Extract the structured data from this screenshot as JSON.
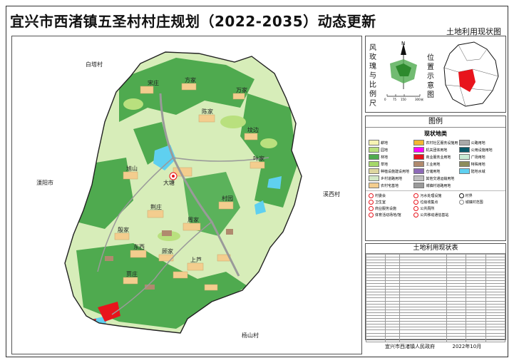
{
  "title": "宜兴市西渚镇五圣村村庄规划（2022-2035）动态更新",
  "subtitle": "土地利用现状图",
  "map": {
    "places": {
      "baita": "白塔村",
      "liyang": "溧阳市",
      "xixi": "溪西村",
      "yangshan": "杨山村"
    },
    "villages": [
      "宋庄",
      "方家",
      "大塘",
      "万家",
      "陈家",
      "坟边",
      "旭山",
      "叶家",
      "村园",
      "荆庄",
      "周家",
      "殷家",
      "东西",
      "顾家",
      "上芦",
      "贾庄"
    ]
  },
  "compass": {
    "label": "风玫瑰与比例尺",
    "north": "N",
    "scale_ticks": [
      "0",
      "75",
      "150",
      "300"
    ],
    "scale_unit": "米"
  },
  "location": {
    "label": "位置示意图"
  },
  "legend": {
    "title": "图例",
    "subtitle": "现状地类",
    "items": [
      {
        "label": "耕地",
        "color": "#f6f3b4"
      },
      {
        "label": "农村社区服务设施用地",
        "color": "#f2b733"
      },
      {
        "label": "公路用地",
        "color": "#a9a9a9"
      },
      {
        "label": "园地",
        "color": "#b9e07e"
      },
      {
        "label": "机关团体用地",
        "color": "#ff00ff"
      },
      {
        "label": "公用设施用地",
        "color": "#0a5a6a"
      },
      {
        "label": "林地",
        "color": "#4faa4f"
      },
      {
        "label": "商业服务业用地",
        "color": "#e8141c"
      },
      {
        "label": "广场用地",
        "color": "#c8ecd4"
      },
      {
        "label": "草地",
        "color": "#a5d86a"
      },
      {
        "label": "工业用地",
        "color": "#b08a6e"
      },
      {
        "label": "特殊用地",
        "color": "#8d8d5c"
      },
      {
        "label": "种植设施建设用地",
        "color": "#ddd6a0"
      },
      {
        "label": "仓储用地",
        "color": "#8e6ab8"
      },
      {
        "label": "陆地水域",
        "color": "#5fd0f0"
      },
      {
        "label": "乡村道路用地",
        "color": "#d2e8c6"
      },
      {
        "label": "其他交通运输用地",
        "color": "#bfbfbf"
      },
      {
        "label": "",
        "color": ""
      },
      {
        "label": "农村宅基地",
        "color": "#f3cd8e"
      },
      {
        "label": "城镇村道路用地",
        "color": "#9a9a9a"
      },
      {
        "label": "",
        "color": ""
      }
    ],
    "symbols": [
      {
        "label": "村委会",
        "color": "#e8141c"
      },
      {
        "label": "污水处理设施",
        "color": "#e8141c"
      },
      {
        "label": "村界",
        "color": "#111111"
      },
      {
        "label": "卫生室",
        "color": "#e8141c"
      },
      {
        "label": "垃圾收集点",
        "color": "#e8141c"
      },
      {
        "label": "城镇村范围",
        "color": "#888888"
      },
      {
        "label": "商业服务设施",
        "color": "#e8141c"
      },
      {
        "label": "公共厕所",
        "color": "#e8141c"
      },
      {
        "label": "",
        "color": ""
      },
      {
        "label": "体育活动场地/馆",
        "color": "#e8141c"
      },
      {
        "label": "公共移动通信基站",
        "color": "#e8141c"
      },
      {
        "label": "",
        "color": ""
      }
    ]
  },
  "status_table": {
    "title": "土地利用现状表"
  },
  "footer": {
    "org": "宜兴市西渚镇人民政府",
    "date": "2022年10月"
  },
  "colors": {
    "forest": "#4faa4f",
    "farmland": "#d7edb9",
    "water": "#5fd0f0",
    "residential": "#f3cd8e",
    "industrial": "#b08a6e",
    "commercial": "#e8141c",
    "road": "#9a9a9a",
    "boundary": "#222222"
  }
}
